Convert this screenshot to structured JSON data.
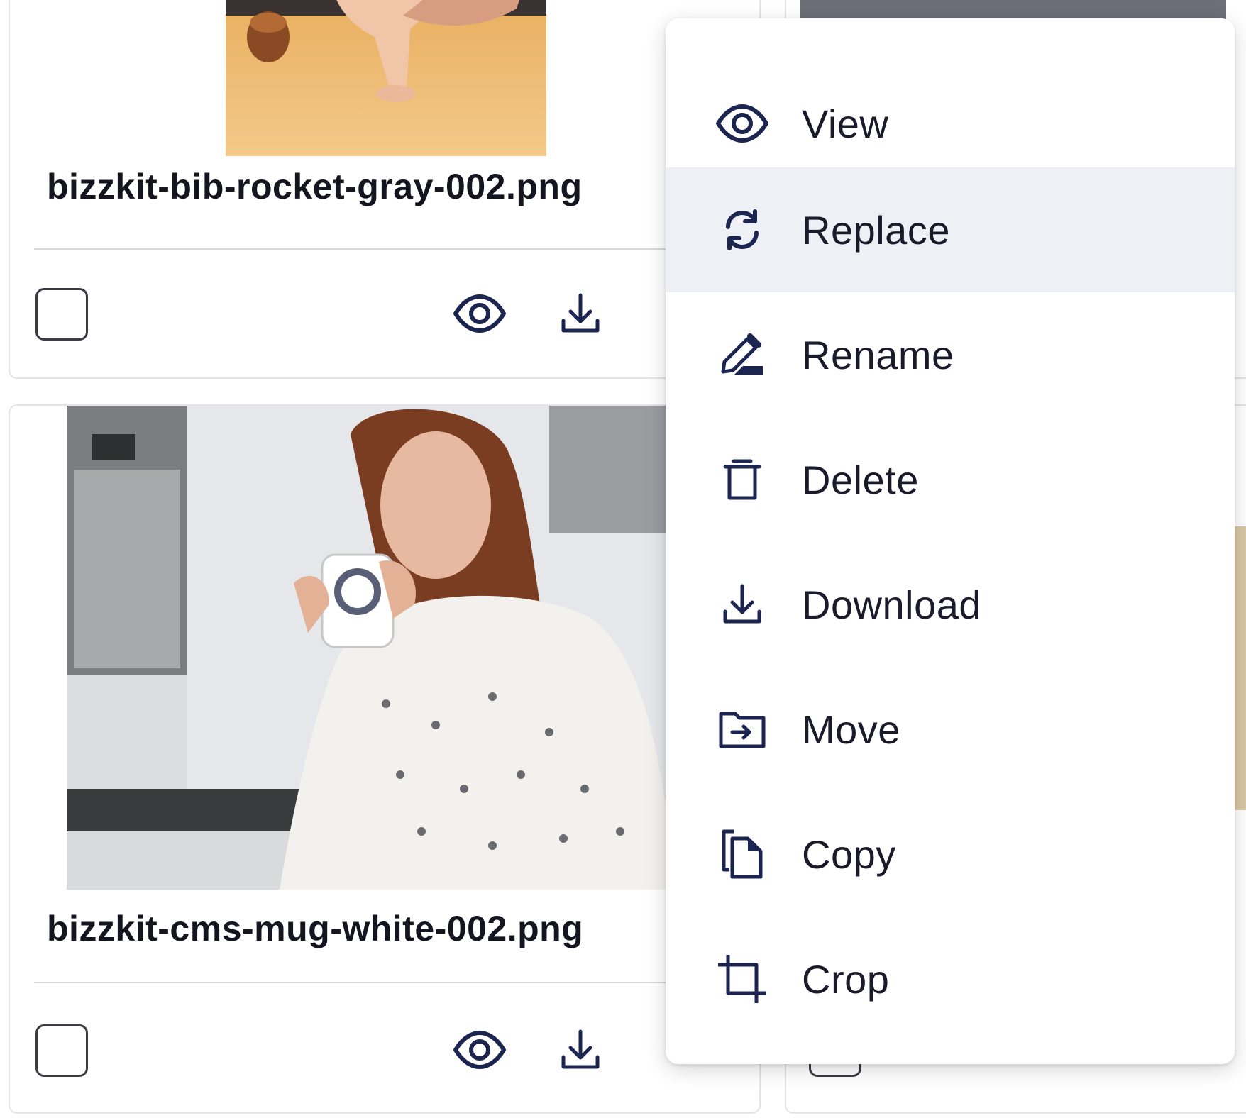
{
  "cards": [
    {
      "filename": "bizzkit-bib-rocket-gray-002.png",
      "select_label": "",
      "view_icon": "eye-icon",
      "download_icon": "download-icon"
    },
    {
      "filename": "bizzkit-cms-mug-white-002.png",
      "select_label": "",
      "view_icon": "eye-icon",
      "download_icon": "download-icon"
    }
  ],
  "context_menu": {
    "items": [
      {
        "label": "View",
        "icon": "eye-icon"
      },
      {
        "label": "Replace",
        "icon": "refresh-icon",
        "highlighted": true
      },
      {
        "label": "Rename",
        "icon": "pencil-icon"
      },
      {
        "label": "Delete",
        "icon": "trash-icon"
      },
      {
        "label": "Download",
        "icon": "download-icon"
      },
      {
        "label": "Move",
        "icon": "folder-move-icon"
      },
      {
        "label": "Copy",
        "icon": "copy-icon"
      },
      {
        "label": "Crop",
        "icon": "crop-icon"
      }
    ]
  },
  "colors": {
    "icon_navy": "#1b2550",
    "highlight": "#eef0f5",
    "border": "#e3e3e8"
  }
}
